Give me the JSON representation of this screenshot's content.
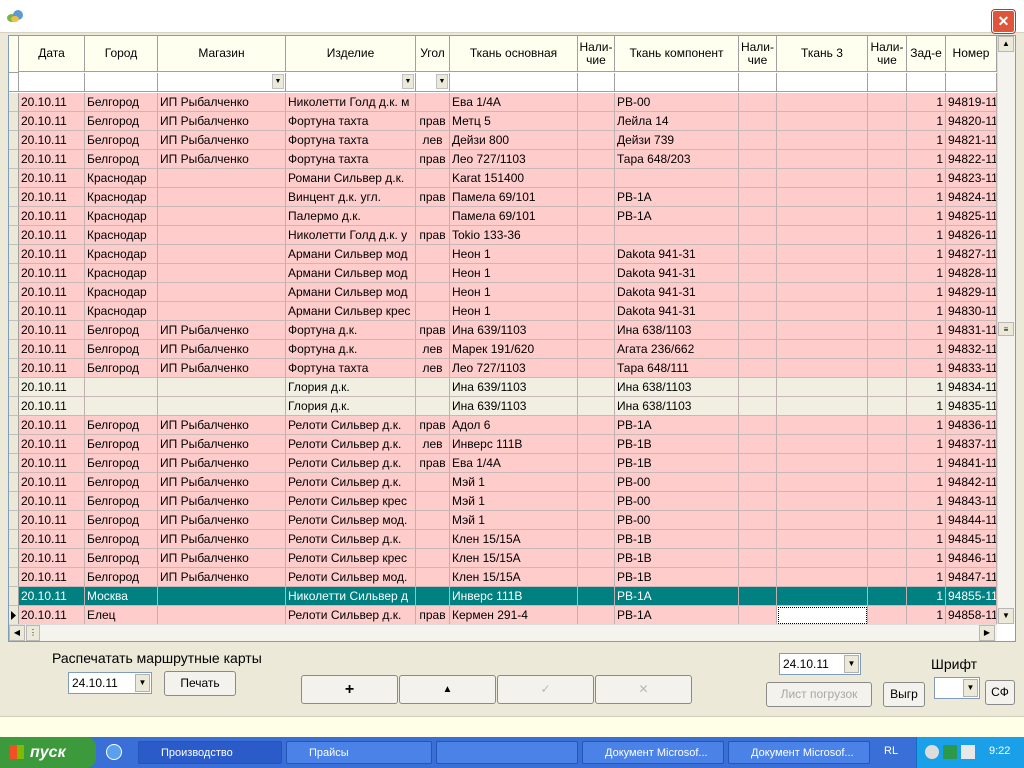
{
  "window": {
    "close_label": "✕"
  },
  "columns": [
    {
      "label": "Дата"
    },
    {
      "label": "Город"
    },
    {
      "label": "Магазин"
    },
    {
      "label": "Изделие"
    },
    {
      "label": "Угол"
    },
    {
      "label": "Ткань основная"
    },
    {
      "label": "Нали-\nчие"
    },
    {
      "label": "Ткань компонент"
    },
    {
      "label": "Нали-\nчие"
    },
    {
      "label": "Ткань 3"
    },
    {
      "label": "Нали-\nчие"
    },
    {
      "label": "Зад-е"
    },
    {
      "label": "Номер"
    }
  ],
  "rows": [
    [
      "20.10.11",
      "Белгород",
      "ИП Рыбалченко",
      "Николетти Голд д.к. м",
      "",
      "Ева 1/4А",
      "",
      "РВ-00",
      "",
      "",
      "",
      "1",
      "94819-11",
      "pink"
    ],
    [
      "20.10.11",
      "Белгород",
      "ИП Рыбалченко",
      "Фортуна тахта",
      "прав",
      "Метц 5",
      "",
      "Лейла 14",
      "",
      "",
      "",
      "1",
      "94820-11",
      "pink"
    ],
    [
      "20.10.11",
      "Белгород",
      "ИП Рыбалченко",
      "Фортуна тахта",
      "лев",
      "Дейзи 800",
      "",
      "Дейзи 739",
      "",
      "",
      "",
      "1",
      "94821-11",
      "pink"
    ],
    [
      "20.10.11",
      "Белгород",
      "ИП Рыбалченко",
      "Фортуна тахта",
      "прав",
      "Лео 727/1103",
      "",
      "Тара 648/203",
      "",
      "",
      "",
      "1",
      "94822-11",
      "pink"
    ],
    [
      "20.10.11",
      "Краснодар",
      "",
      "Романи Сильвер д.к.",
      "",
      "Karat 151400",
      "",
      "",
      "",
      "",
      "",
      "1",
      "94823-11",
      "pink"
    ],
    [
      "20.10.11",
      "Краснодар",
      "",
      "Винцент д.к. угл.",
      "прав",
      "Памела 69/101",
      "",
      "РВ-1А",
      "",
      "",
      "",
      "1",
      "94824-11",
      "pink"
    ],
    [
      "20.10.11",
      "Краснодар",
      "",
      "Палермо д.к.",
      "",
      "Памела 69/101",
      "",
      "РВ-1А",
      "",
      "",
      "",
      "1",
      "94825-11",
      "pink"
    ],
    [
      "20.10.11",
      "Краснодар",
      "",
      "Николетти Голд д.к. у",
      "прав",
      "Tokio 133-36",
      "",
      "",
      "",
      "",
      "",
      "1",
      "94826-11",
      "pink"
    ],
    [
      "20.10.11",
      "Краснодар",
      "",
      "Армани Сильвер мод",
      "",
      "Неон 1",
      "",
      "Dakota 941-31",
      "",
      "",
      "",
      "1",
      "94827-11",
      "pink"
    ],
    [
      "20.10.11",
      "Краснодар",
      "",
      "Армани Сильвер мод",
      "",
      "Неон 1",
      "",
      "Dakota 941-31",
      "",
      "",
      "",
      "1",
      "94828-11",
      "pink"
    ],
    [
      "20.10.11",
      "Краснодар",
      "",
      "Армани Сильвер мод",
      "",
      "Неон 1",
      "",
      "Dakota 941-31",
      "",
      "",
      "",
      "1",
      "94829-11",
      "pink"
    ],
    [
      "20.10.11",
      "Краснодар",
      "",
      "Армани Сильвер крес",
      "",
      "Неон 1",
      "",
      "Dakota 941-31",
      "",
      "",
      "",
      "1",
      "94830-11",
      "pink"
    ],
    [
      "20.10.11",
      "Белгород",
      "ИП Рыбалченко",
      "Фортуна д.к.",
      "прав",
      "Ина 639/1103",
      "",
      "Ина 638/1103",
      "",
      "",
      "",
      "1",
      "94831-11",
      "pink"
    ],
    [
      "20.10.11",
      "Белгород",
      "ИП Рыбалченко",
      "Фортуна д.к.",
      "лев",
      "Марек 191/620",
      "",
      "Агата 236/662",
      "",
      "",
      "",
      "1",
      "94832-11",
      "pink"
    ],
    [
      "20.10.11",
      "Белгород",
      "ИП Рыбалченко",
      "Фортуна тахта",
      "лев",
      "Лео 727/1103",
      "",
      "Тара 648/111",
      "",
      "",
      "",
      "1",
      "94833-11",
      "pink"
    ],
    [
      "20.10.11",
      "",
      "",
      "Глория д.к.",
      "",
      "Ина 639/1103",
      "",
      "Ина 638/1103",
      "",
      "",
      "",
      "1",
      "94834-11",
      "beige"
    ],
    [
      "20.10.11",
      "",
      "",
      "Глория д.к.",
      "",
      "Ина 639/1103",
      "",
      "Ина 638/1103",
      "",
      "",
      "",
      "1",
      "94835-11",
      "beige"
    ],
    [
      "20.10.11",
      "Белгород",
      "ИП Рыбалченко",
      "Релоти Сильвер д.к.",
      "прав",
      "Адол 6",
      "",
      "РВ-1А",
      "",
      "",
      "",
      "1",
      "94836-11",
      "pink"
    ],
    [
      "20.10.11",
      "Белгород",
      "ИП Рыбалченко",
      "Релоти Сильвер д.к.",
      "лев",
      "Инверс 111В",
      "",
      "РВ-1В",
      "",
      "",
      "",
      "1",
      "94837-11",
      "pink"
    ],
    [
      "20.10.11",
      "Белгород",
      "ИП Рыбалченко",
      "Релоти Сильвер д.к.",
      "прав",
      "Ева 1/4А",
      "",
      "РВ-1В",
      "",
      "",
      "",
      "1",
      "94841-11",
      "pink"
    ],
    [
      "20.10.11",
      "Белгород",
      "ИП Рыбалченко",
      "Релоти Сильвер д.к.",
      "",
      "Мэй 1",
      "",
      "РВ-00",
      "",
      "",
      "",
      "1",
      "94842-11",
      "pink"
    ],
    [
      "20.10.11",
      "Белгород",
      "ИП Рыбалченко",
      "Релоти Сильвер крес",
      "",
      "Мэй 1",
      "",
      "РВ-00",
      "",
      "",
      "",
      "1",
      "94843-11",
      "pink"
    ],
    [
      "20.10.11",
      "Белгород",
      "ИП Рыбалченко",
      "Релоти Сильвер мод.",
      "",
      "Мэй 1",
      "",
      "РВ-00",
      "",
      "",
      "",
      "1",
      "94844-11",
      "pink"
    ],
    [
      "20.10.11",
      "Белгород",
      "ИП Рыбалченко",
      "Релоти Сильвер д.к.",
      "",
      "Клен 15/15А",
      "",
      "РВ-1В",
      "",
      "",
      "",
      "1",
      "94845-11",
      "pink"
    ],
    [
      "20.10.11",
      "Белгород",
      "ИП Рыбалченко",
      "Релоти Сильвер крес",
      "",
      "Клен 15/15А",
      "",
      "РВ-1В",
      "",
      "",
      "",
      "1",
      "94846-11",
      "pink"
    ],
    [
      "20.10.11",
      "Белгород",
      "ИП Рыбалченко",
      "Релоти Сильвер мод.",
      "",
      "Клен 15/15А",
      "",
      "РВ-1В",
      "",
      "",
      "",
      "1",
      "94847-11",
      "pink"
    ],
    [
      "20.10.11",
      "Москва",
      "",
      "Николетти Сильвер д",
      "",
      "Инверс 111В",
      "",
      "РВ-1А",
      "",
      "",
      "",
      "1",
      "94855-11",
      "sel"
    ],
    [
      "20.10.11",
      "Елец",
      "",
      "Релоти Сильвер д.к.",
      "прав",
      "Кермен 291-4",
      "",
      "РВ-1А",
      "",
      "",
      "",
      "1",
      "94858-11",
      "white"
    ]
  ],
  "controls": {
    "print_routes_label": "Распечатать маршрутные карты",
    "print_date": "24.10.11",
    "print_button": "Печать",
    "nav_add": "+",
    "nav_up": "▲",
    "nav_check": "✓",
    "nav_delete": "✕",
    "load_date": "24.10.11",
    "load_sheet_button": "Лист погрузок",
    "vygr_button": "Выгр",
    "font_label": "Шрифт",
    "font_value": "",
    "sf_button": "СФ"
  },
  "taskbar": {
    "start_label": "пуск",
    "tasks": [
      "Производство",
      "Прайсы",
      "",
      "Документ Microsof...",
      "Документ Microsof..."
    ],
    "lang": "RL",
    "clock": "9:22"
  },
  "colors": {
    "row_pink": "#ffcccc",
    "row_beige": "#f0efe2",
    "row_selected": "#008080",
    "taskbar": "#3a6fd8",
    "start": "#3c9a3c"
  }
}
